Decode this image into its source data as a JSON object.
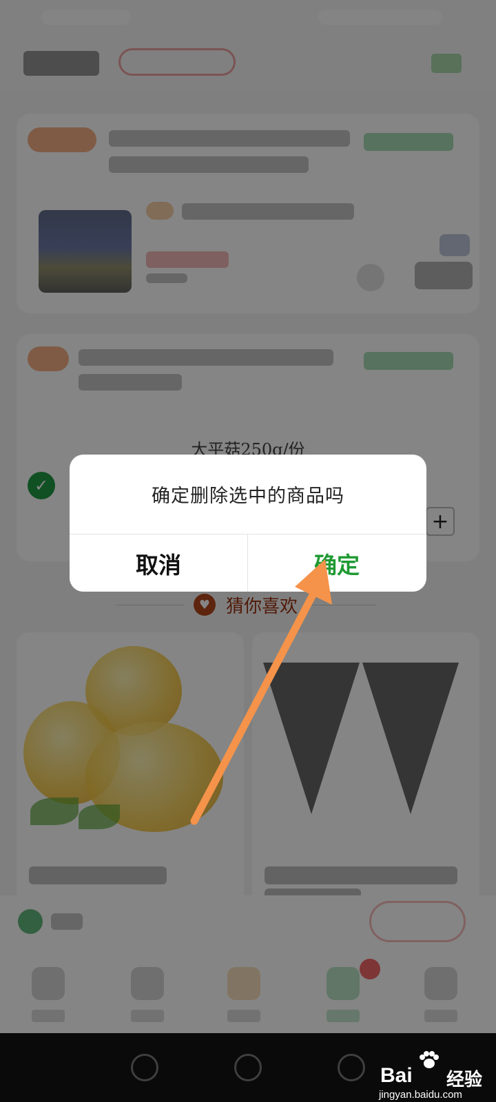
{
  "cart_item": {
    "product_name": "大平菇250g/份"
  },
  "recommend": {
    "title": "猜你喜欢"
  },
  "dialog": {
    "message": "确定删除选中的商品吗",
    "cancel_label": "取消",
    "confirm_label": "确定"
  },
  "watermark": {
    "brand": "Bai",
    "brand_suffix": "经验",
    "url": "jingyan.baidu.com"
  },
  "colors": {
    "confirm_green": "#1f9a33",
    "annotation_arrow": "#f5934a",
    "check_green": "#1f9a44",
    "guess_accent": "#9c3412"
  },
  "icons": {
    "check": "check-icon",
    "plus": "plus-icon",
    "heart": "heart-icon",
    "paw": "baidu-paw-icon"
  }
}
